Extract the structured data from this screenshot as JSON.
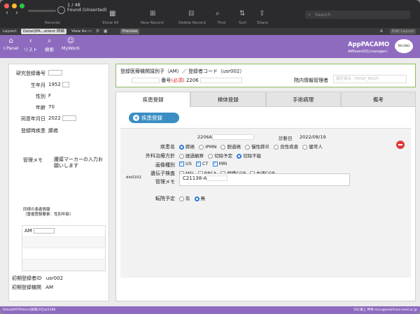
{
  "toolbar": {
    "record_position": "1 / 48",
    "record_found": "Found (Unsorted)",
    "records_label": "Records",
    "show_all": "Show All",
    "new_record": "New Record",
    "delete_record": "Delete Record",
    "find": "Find",
    "sort": "Sort",
    "share": "Share",
    "search_placeholder": "Search"
  },
  "layoutbar": {
    "layout_label": "Layout:",
    "layout_value": "Detail|PA...atient 詳細",
    "view_as": "View As:",
    "preview": "Preview",
    "edit_layout": "Edit Layout",
    "font_icon": "A"
  },
  "header": {
    "nav": [
      {
        "icon": "panel-icon",
        "label": "I.Panel"
      },
      {
        "icon": "back-icon",
        "label": "リスト"
      },
      {
        "icon": "search-icon",
        "label": "検索"
      },
      {
        "icon": "user-icon",
        "label": "MyWork"
      }
    ],
    "app_title": "AppPACAMO",
    "app_subtitle": "AMfuser001(manager)",
    "logo_text": "PACAMO"
  },
  "patient": {
    "fields": [
      {
        "label": "研究登録番号",
        "value": ""
      },
      {
        "label": "生年月",
        "value": "1952"
      },
      {
        "label": "性別",
        "value": "F"
      },
      {
        "label": "年齢",
        "value": "70"
      },
      {
        "label": "同意年月日",
        "value": "2022"
      },
      {
        "label": "登録時疾患",
        "value": "膵癌"
      }
    ],
    "memo_label": "管理メモ",
    "memo_value": "腫瘍マーカーの入力お願いします",
    "family_label": "同様の患者情報\n（重複登録要素：性別年齢）",
    "family_rows": [
      "AM",
      "",
      "",
      ""
    ],
    "initial_registrant_label": "初期登録者ID",
    "initial_registrant_value": "usr002",
    "initial_org_label": "初期登録機関",
    "initial_org_value": "AM"
  },
  "registration": {
    "title": "登録医療機関識別子（AM）／ 登録者コード（usr002）",
    "number_label": "番号",
    "required": "(必須)",
    "number_value": "2206",
    "hospital_admin_label": "院内情報管理者",
    "hospital_admin_placeholder": "責任者名（HDSP_RESP）"
  },
  "tabs": [
    "疾患登録",
    "検体登録",
    "手術病理",
    "備考"
  ],
  "disease": {
    "add_button": "疾患登録",
    "record_id": "dis0102",
    "code_value": "2206A",
    "diagnosis_date_label": "診断日",
    "diagnosis_date_value": "2022/08/19",
    "disease_name_label": "疾患名",
    "disease_options": [
      "膵癌",
      "IPMN",
      "胆道癌",
      "慢性膵炎",
      "良性疾患",
      "健常人"
    ],
    "disease_selected": 0,
    "surgery_label": "外科治療方針",
    "surgery_options": [
      "経過観察",
      "切除予定",
      "切除不能"
    ],
    "surgery_selected": 2,
    "imaging_label": "画像種別",
    "imaging_options": [
      "US",
      "CT",
      "MRI"
    ],
    "imaging_checked": [
      true,
      true,
      true
    ],
    "genetic_label": "遺伝子検査",
    "genetic_options": [
      "MSI",
      "BRCA",
      "組織CGP",
      "血液CGP"
    ],
    "genetic_checked": [
      false,
      false,
      false,
      false
    ],
    "memo_label": "管理メモ",
    "memo_value": "C21138-A",
    "transfer_label": "転院予定",
    "transfer_options": [
      "有",
      "無"
    ],
    "transfer_selected": 1
  },
  "footer": {
    "left": "Detail|PATIPatient詳細(3ゼ|ut1588",
    "right": "SSC株上 神崎 micu@washhare-med.ac.jp"
  }
}
